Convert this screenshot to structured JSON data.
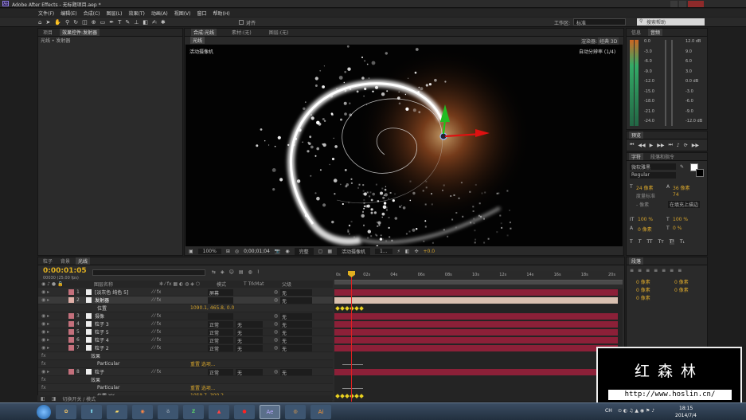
{
  "app": {
    "title": "Adobe After Effects - 无标题项目.aep *",
    "menu": [
      "文件(F)",
      "编辑(E)",
      "合成(C)",
      "图层(L)",
      "效果(T)",
      "动画(A)",
      "视图(V)",
      "窗口",
      "帮助(H)"
    ],
    "align_label": "对齐",
    "workspace_label": "工作区:",
    "workspace_value": "标准",
    "search_placeholder": "搜索帮助"
  },
  "project_panel": {
    "tabs": [
      "项目",
      "效果控件:发射器"
    ],
    "breadcrumb": "光线 • 发射器"
  },
  "viewer": {
    "tabs": [
      "合成:光线",
      "素材:(无)",
      "图层:(无)"
    ],
    "comp_chip": "光线",
    "camera_label": "活动摄像机",
    "renderer_label": "渲染器:",
    "renderer_value": "经典 3D",
    "resolution_label": "自动分辨率 (1/4)",
    "footer": {
      "zoom": "100%",
      "timecode": "0;00;01;04",
      "quality": "完整",
      "view": "活动摄像机",
      "views": "1...",
      "exposure": "+0.0"
    }
  },
  "audio_panel": {
    "tabs": [
      "信息",
      "音频"
    ],
    "left_scale": [
      "0.0",
      "-3.0",
      "-6.0",
      "-9.0",
      "-12.0",
      "-15.0",
      "-18.0",
      "-21.0",
      "-24.0"
    ],
    "right_scale": [
      "12.0 dB",
      "9.0",
      "6.0",
      "3.0",
      "0.0 dB",
      "-3.0",
      "-6.0",
      "-9.0",
      "-12.0 dB"
    ]
  },
  "preview_panel": {
    "title": "预览"
  },
  "character_panel": {
    "tabs": [
      "字符",
      "段落和指令"
    ],
    "font": "微软雅黑",
    "style": "Regular",
    "size": "24 像素",
    "leading": "36 像素",
    "tracking_label": "度量标准",
    "tracking_value": "74",
    "kerning": "- 像素",
    "stroke": "在填充上描边",
    "v_scale": "100 %",
    "h_scale": "100 %",
    "baseline": "0 像素",
    "tsume": "0 %"
  },
  "paragraph_panel": {
    "title": "段落",
    "fields": [
      "0 像素",
      "0 像素",
      "0 像素",
      "0 像素",
      "0 像素"
    ]
  },
  "timeline": {
    "tabs": [
      "粒子",
      "背景",
      "光线"
    ],
    "timecode": "0:00:01:05",
    "fps": "00030 (25.00 fps)",
    "headers": {
      "name": "图层名称",
      "mode": "模式",
      "trkmat": "T TrkMat",
      "parent": "父级"
    },
    "ruler": [
      "0s",
      "02s",
      "04s",
      "06s",
      "08s",
      "10s",
      "12s",
      "14s",
      "16s",
      "18s",
      "20s"
    ],
    "rows": [
      {
        "num": "1",
        "name": "[淡灰色 纯色 5]",
        "mode": "屏幕",
        "trk": "",
        "parent": "无",
        "color": "#c4707c",
        "kind": "layer"
      },
      {
        "num": "2",
        "name": "发射器",
        "mode": "",
        "trk": "",
        "parent": "无",
        "color": "#e0b0a8",
        "kind": "layer"
      },
      {
        "num": "",
        "name": "位置",
        "value": "1090.1, 465.8, 0.0",
        "kind": "prop"
      },
      {
        "num": "3",
        "name": "摄像",
        "mode": "",
        "trk": "",
        "parent": "无",
        "color": "#c4707c",
        "kind": "layer"
      },
      {
        "num": "4",
        "name": "粒子 3",
        "mode": "正常",
        "trk": "无",
        "parent": "无",
        "color": "#c4707c",
        "kind": "layer"
      },
      {
        "num": "5",
        "name": "粒子 5",
        "mode": "正常",
        "trk": "无",
        "parent": "无",
        "color": "#c4707c",
        "kind": "layer"
      },
      {
        "num": "6",
        "name": "粒子 4",
        "mode": "正常",
        "trk": "无",
        "parent": "无",
        "color": "#c4707c",
        "kind": "layer"
      },
      {
        "num": "7",
        "name": "粒子 2",
        "mode": "正常",
        "trk": "无",
        "parent": "无",
        "color": "#c4707c",
        "kind": "layer"
      },
      {
        "num": "",
        "name": "效果",
        "kind": "group"
      },
      {
        "num": "",
        "name": "Particular",
        "value": "重置  选项...",
        "kind": "fx"
      },
      {
        "num": "8",
        "name": "粒子",
        "mode": "正常",
        "trk": "无",
        "parent": "无",
        "color": "#c4707c",
        "kind": "layer"
      },
      {
        "num": "",
        "name": "效果",
        "kind": "group"
      },
      {
        "num": "",
        "name": "Particular",
        "value": "重置  选项...",
        "kind": "fx"
      },
      {
        "num": "",
        "name": "位置 XY",
        "value": "1059.7, 300.2",
        "kind": "prop"
      }
    ],
    "footer_label": "切换开关 / 模式"
  },
  "watermark": {
    "logo": "红森林",
    "url": "http://www.hoslin.cn/"
  },
  "taskbar": {
    "time": "18:15",
    "date": "2014/7/4",
    "lang": "CH"
  },
  "colors": {
    "accent": "#d4a32c",
    "layer_bar": "#8c2038",
    "layer_bar_light": "#d9c0b0",
    "playhead": "#e02020"
  }
}
